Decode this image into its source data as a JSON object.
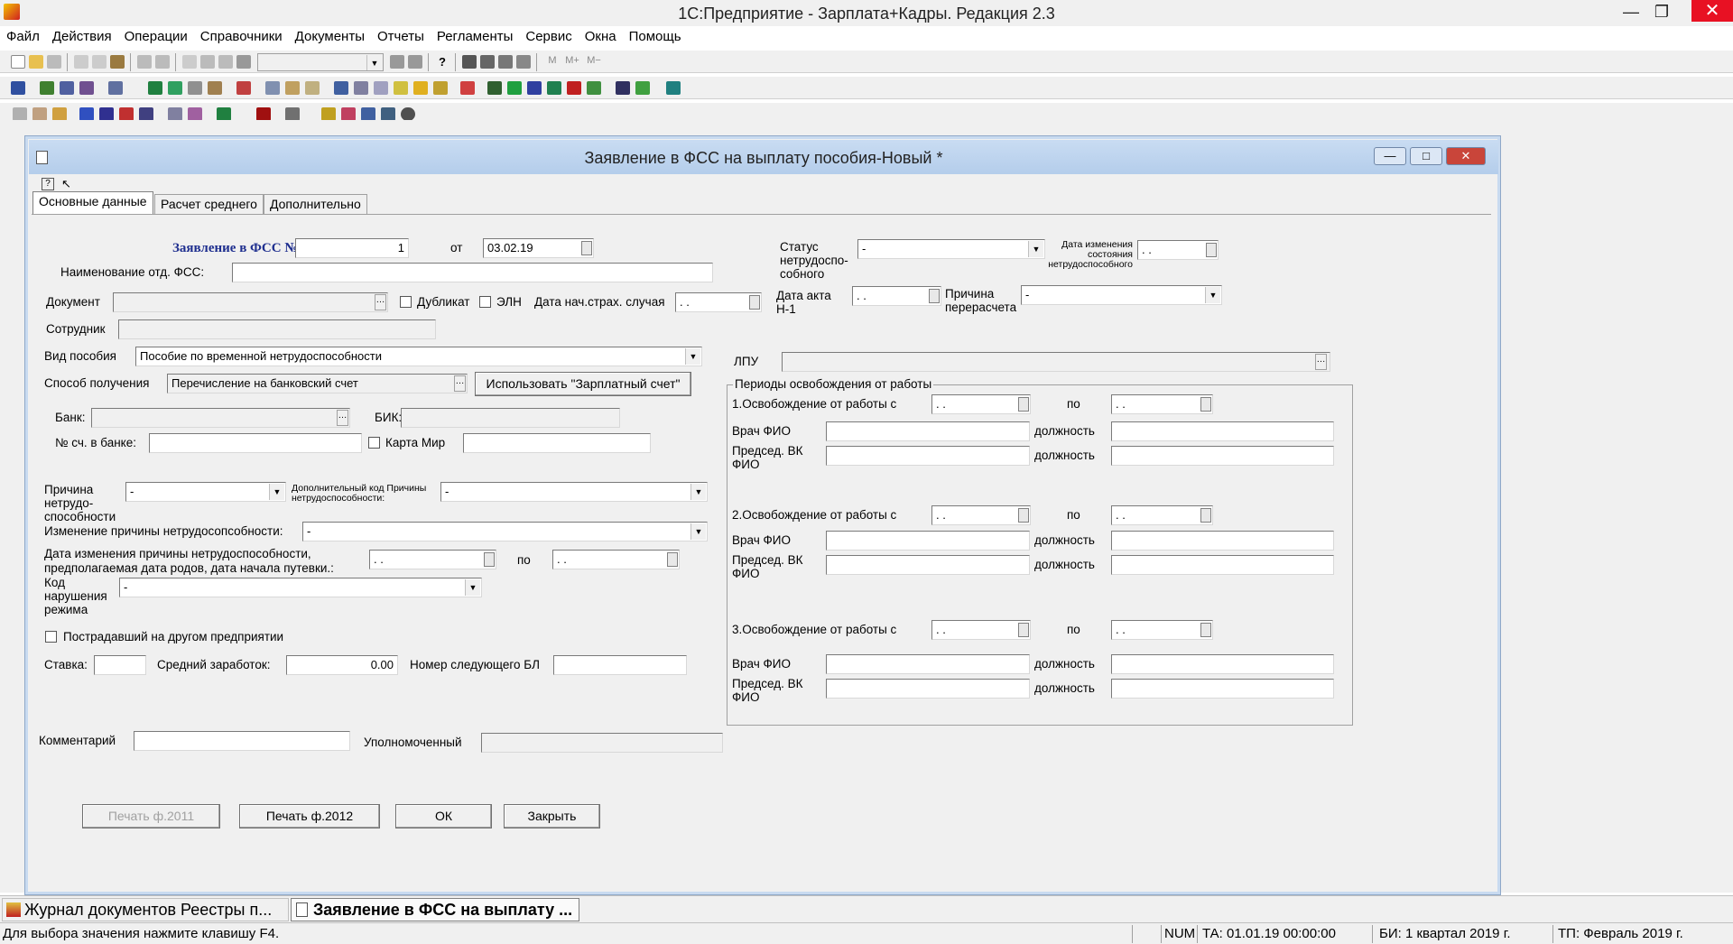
{
  "app": {
    "title": "1С:Предприятие - Зарплата+Кадры. Редакция 2.3",
    "minimize": "—",
    "restore": "❐",
    "close": "✕"
  },
  "menu": [
    "Файл",
    "Действия",
    "Операции",
    "Справочники",
    "Документы",
    "Отчеты",
    "Регламенты",
    "Сервис",
    "Окна",
    "Помощь"
  ],
  "toolbar_text": {
    "m": "M",
    "mplus": "M+",
    "mminus": "M−"
  },
  "window": {
    "title": "Заявление в ФСС на выплату пособия-Новый *",
    "minimize": "—",
    "restore": "□",
    "close": "✕"
  },
  "tabs": [
    "Основные данные",
    "Расчет среднего",
    "Дополнительно"
  ],
  "form": {
    "app_no_label": "Заявление в ФСС №",
    "app_no": "1",
    "from_label": "от",
    "date": "03.02.19",
    "fss_name_label": "Наименование отд. ФСС:",
    "fss_name": "",
    "doc_label": "Документ",
    "duplicate_label": "Дубликат",
    "eln_label": "ЭЛН",
    "insured_date_label": "Дата нач.страх. случая",
    "insured_date": ". .",
    "employee_label": "Сотрудник",
    "employee": "",
    "benefit_type_label": "Вид пособия",
    "benefit_type": "Пособие по временной нетрудоспособности",
    "method_label": "Способ получения",
    "method": "Перечисление на банковский счет",
    "use_salary_btn": "Использовать \"Зарплатный счет\"",
    "bank_label": "Банк:",
    "bik_label": "БИК:",
    "account_label": "№ сч. в банке:",
    "mir_label": "Карта Мир",
    "reason_label": "Причина нетрудо-способности",
    "reason": "-",
    "add_reason_label": "Дополнительный код Причины нетрудоспособности:",
    "add_reason": "-",
    "reason_change_label": "Изменение причины нетрудосопсобности:",
    "reason_change": "-",
    "change_date_label": "Дата изменения причины нетрудоспособности, предполагаемая дата родов, дата начала путевки.:",
    "change_from": ". .",
    "change_to_label": "по",
    "change_to": ". .",
    "violation_label": "Код нарушения режима",
    "violation": "-",
    "other_company_label": "Пострадавший на другом предприятии",
    "rate_label": "Ставка:",
    "rate": "",
    "avg_label": "Средний заработок:",
    "avg": "0.00",
    "next_bl_label": "Номер следующего БЛ",
    "next_bl": "",
    "status_label": "Статус нетрудоспо-собного",
    "status": "-",
    "status_date_label": "Дата изменения состояния нетрудоспособного",
    "status_date": ". .",
    "act_date_label": "Дата акта Н-1",
    "act_date": ". .",
    "recalc_label": "Причина перерасчета",
    "recalc": "-",
    "lpu_label": "ЛПУ",
    "lpu": "",
    "comment_label": "Комментарий",
    "comment": "",
    "authorized_label": "Уполномоченный",
    "authorized": ""
  },
  "periods": {
    "title": "Периоды освобождения от работы",
    "to_label": "по",
    "doctor_label": "Врач ФИО",
    "chair_label": "Председ. ВК ФИО",
    "position_label": "должность",
    "items": [
      {
        "label": "1.Освобождение от работы с",
        "from": ". .",
        "to": ". ."
      },
      {
        "label": "2.Освобождение от работы с",
        "from": ". .",
        "to": ". ."
      },
      {
        "label": "3.Освобождение от работы с",
        "from": ". .",
        "to": ". ."
      }
    ]
  },
  "buttons": {
    "print2011": "Печать ф.2011",
    "print2012": "Печать ф.2012",
    "ok": "ОК",
    "close": "Закрыть"
  },
  "taskbar": {
    "journal": "Журнал документов  Реестры п...",
    "current": "Заявление в ФСС на выплату ..."
  },
  "status": {
    "hint": "Для выбора значения нажмите клавишу F4.",
    "num": "NUM",
    "ta": "ТА: 01.01.19  00:00:00",
    "bi": "БИ: 1 квартал 2019 г.",
    "tp": "ТП: Февраль 2019 г."
  },
  "colors": {
    "title_blue": "#1f2f8f",
    "accent": "#c9dcf2",
    "close_red": "#e81123"
  }
}
